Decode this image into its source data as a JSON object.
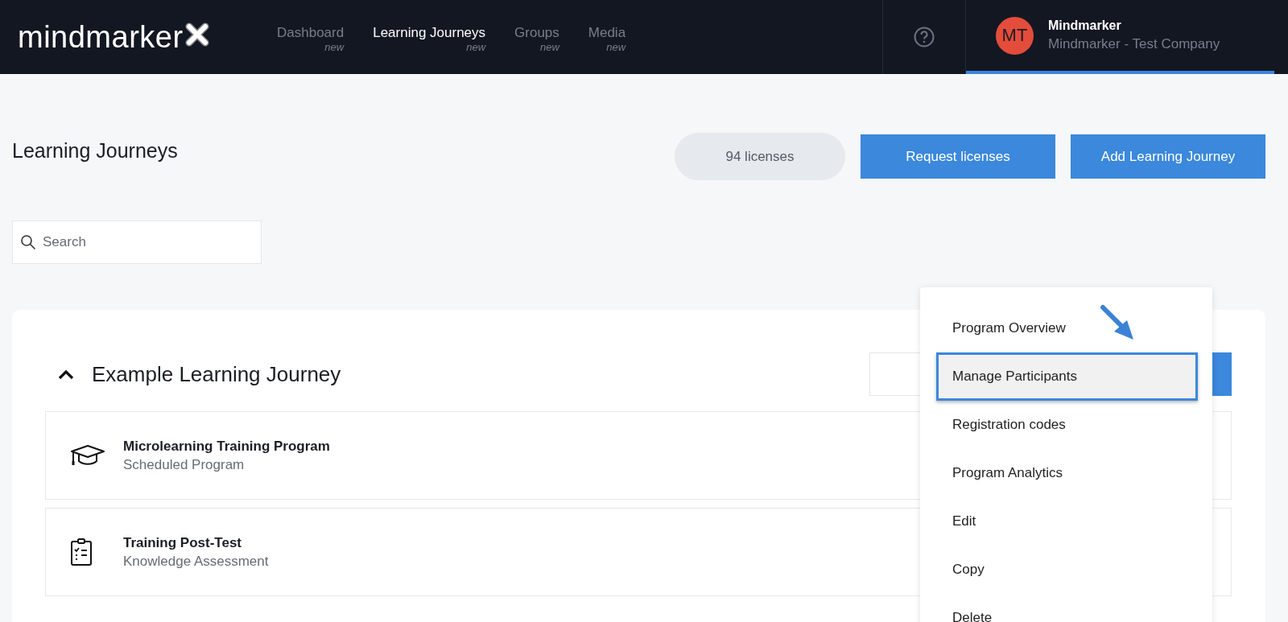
{
  "header": {
    "logo": "mindmarker",
    "nav": [
      {
        "label": "Dashboard",
        "badge": "new",
        "selected": false
      },
      {
        "label": "Learning Journeys",
        "badge": "new",
        "selected": true
      },
      {
        "label": "Groups",
        "badge": "new",
        "selected": false
      },
      {
        "label": "Media",
        "badge": "new",
        "selected": false
      }
    ],
    "user": {
      "initials": "MT",
      "name": "Mindmarker",
      "company": "Mindmarker - Test Company"
    }
  },
  "page": {
    "title": "Learning Journeys",
    "licenses": "94 licenses",
    "buttons": [
      "Request licenses",
      "Add Learning Journey"
    ],
    "search": {
      "placeholder": "Search"
    }
  },
  "journey": {
    "title": "Example Learning Journey",
    "expanded": true,
    "items": [
      {
        "kind": "program",
        "title": "Microlearning Training Program",
        "subtitle": "Scheduled Program"
      },
      {
        "kind": "test",
        "title": "Training Post-Test",
        "subtitle": "Knowledge Assessment"
      }
    ]
  },
  "menu": {
    "items": [
      {
        "label": "Program Overview",
        "selected": false
      },
      {
        "label": "Manage Participants",
        "selected": true
      },
      {
        "label": "Registration codes",
        "selected": false
      },
      {
        "label": "Program Analytics",
        "selected": false
      },
      {
        "label": "Edit",
        "selected": false
      },
      {
        "label": "Copy",
        "selected": false
      },
      {
        "label": "Delete",
        "selected": false
      }
    ]
  }
}
